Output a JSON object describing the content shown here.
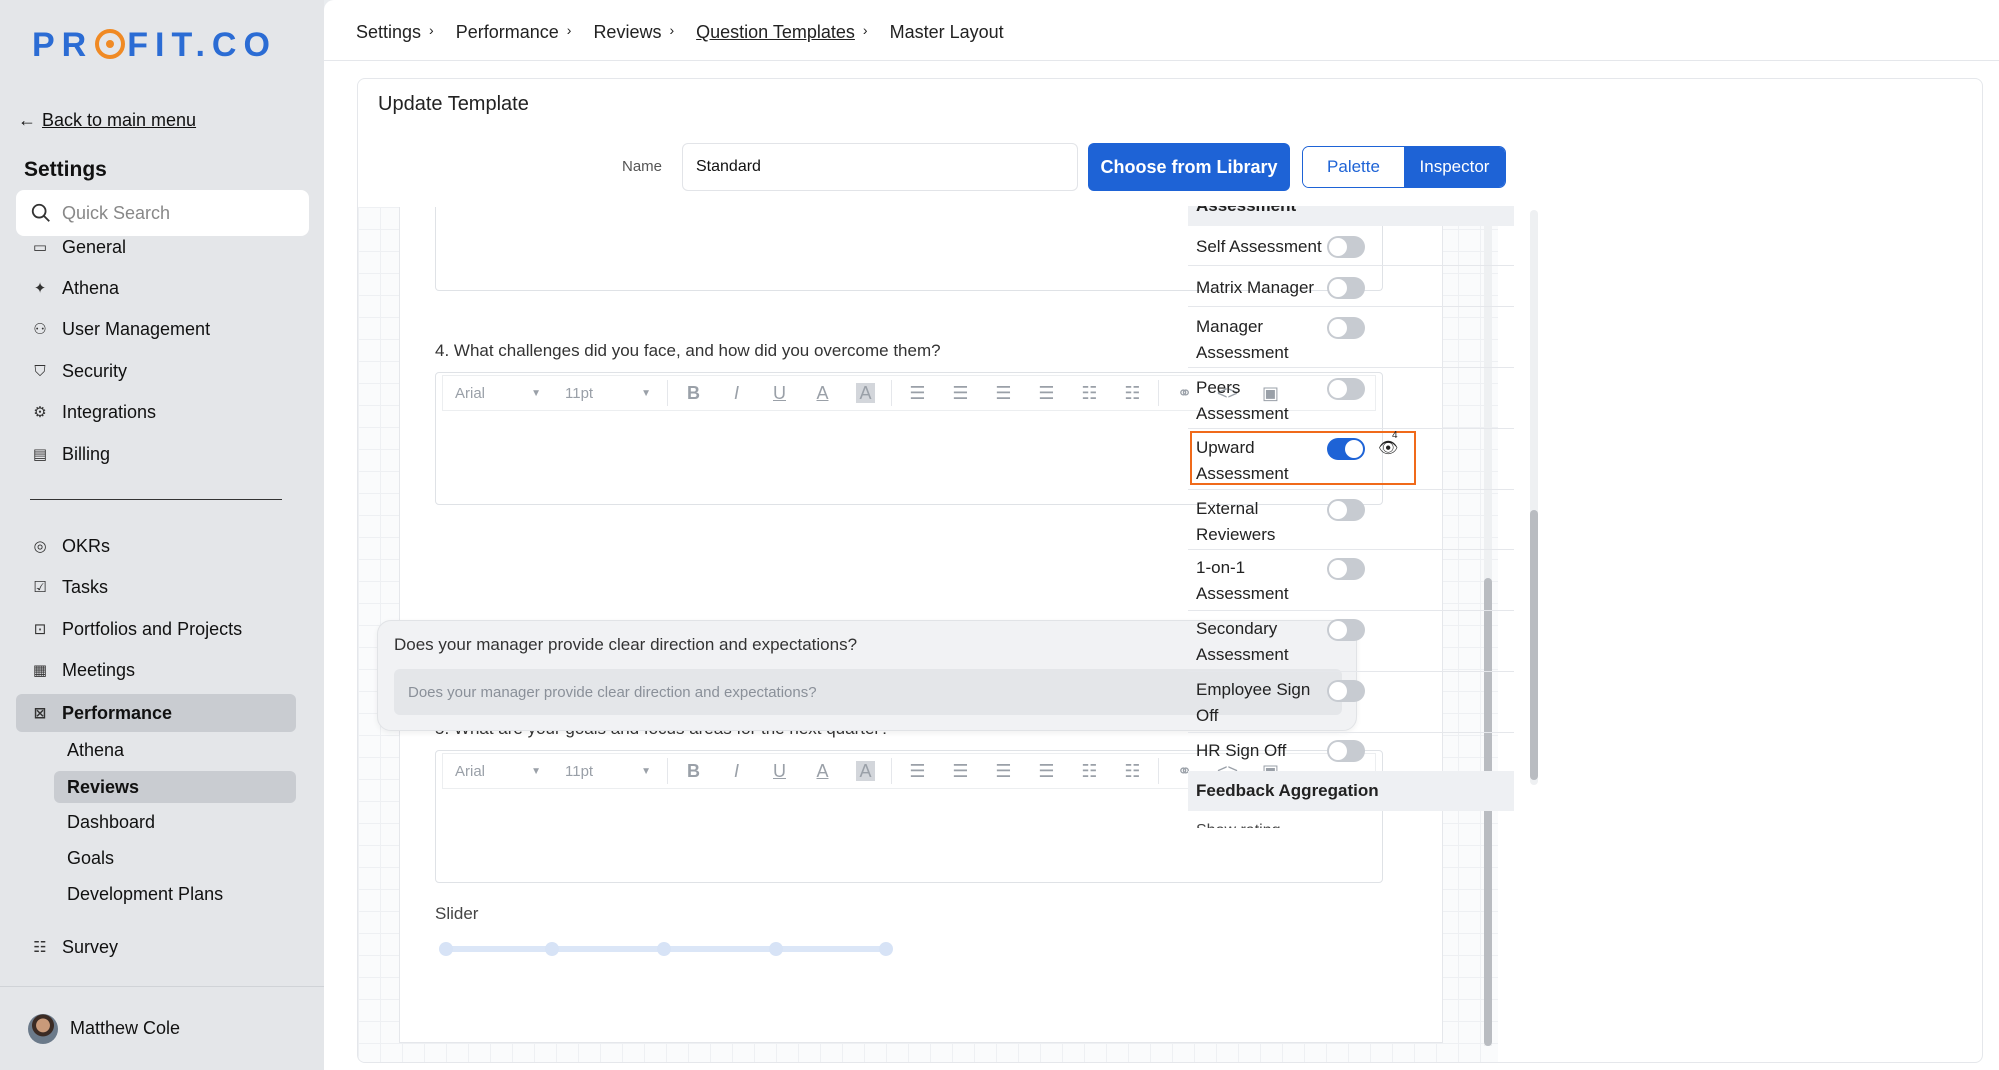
{
  "brand": {
    "logo_text_1": "PR",
    "logo_text_2": "FIT.CO",
    "primary_color": "#1e63d6",
    "accent_color": "#f08a24"
  },
  "sidebar": {
    "back_label": "Back to main menu",
    "section_title": "Settings",
    "search_placeholder": "Quick Search",
    "items": [
      {
        "label": "General",
        "icon": "monitor-icon"
      },
      {
        "label": "Athena",
        "icon": "sparkle-icon"
      },
      {
        "label": "User Management",
        "icon": "user-icon"
      },
      {
        "label": "Security",
        "icon": "shield-icon"
      },
      {
        "label": "Integrations",
        "icon": "gear-icon"
      },
      {
        "label": "Billing",
        "icon": "receipt-icon"
      }
    ],
    "modules": [
      {
        "label": "OKRs",
        "icon": "target-icon"
      },
      {
        "label": "Tasks",
        "icon": "checklist-icon"
      },
      {
        "label": "Portfolios and Projects",
        "icon": "briefcase-icon"
      },
      {
        "label": "Meetings",
        "icon": "calendar-icon"
      },
      {
        "label": "Performance",
        "icon": "chart-icon"
      }
    ],
    "performance_sub": [
      "Athena",
      "Reviews",
      "Dashboard",
      "Goals",
      "Development Plans"
    ],
    "survey_label": "Survey",
    "user_name": "Matthew Cole"
  },
  "breadcrumb": [
    "Settings",
    "Performance",
    "Reviews",
    "Question Templates",
    "Master Layout"
  ],
  "template": {
    "title": "Update Template",
    "name_label": "Name",
    "name_value": "Standard",
    "library_button": "Choose from Library"
  },
  "editor": {
    "font": "Arial",
    "size": "11pt",
    "q4": "4. What challenges did you face, and how did you overcome them?",
    "highlight_question": "Does your manager provide clear direction and expectations?",
    "highlight_placeholder": "Does your manager provide clear direction and expectations?",
    "q5": "5. What are your goals and focus areas for the next quarter?",
    "slider_label": "Slider"
  },
  "panel": {
    "tabs": {
      "palette": "Palette",
      "inspector": "Inspector"
    },
    "cut_header": "Assessment",
    "rows": [
      {
        "label": "Self Assessment",
        "on": false
      },
      {
        "label": "Matrix Manager",
        "on": false
      },
      {
        "label": "Manager Assessment",
        "on": false
      },
      {
        "label": "Peers Assessment",
        "on": false
      },
      {
        "label": "Upward Assessment",
        "on": true
      },
      {
        "label": "External Reviewers",
        "on": false
      },
      {
        "label": "1-on-1 Assessment",
        "on": false
      },
      {
        "label": "Secondary Assessment",
        "on": false
      },
      {
        "label": "Employee Sign Off",
        "on": false
      },
      {
        "label": "HR Sign Off",
        "on": false
      }
    ],
    "eye_count": "4",
    "feedback_title": "Feedback Aggregation",
    "cut_bottom": "Show rating"
  }
}
